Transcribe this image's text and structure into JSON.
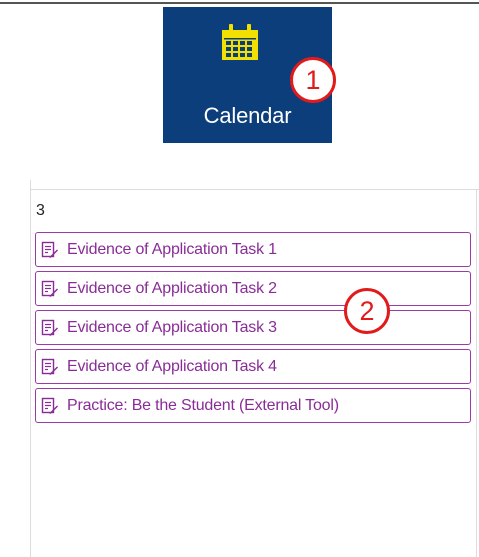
{
  "nav": {
    "calendar_label": "Calendar"
  },
  "callouts": {
    "one": "1",
    "two": "2"
  },
  "day": {
    "number": "3"
  },
  "events": [
    {
      "title": "Evidence of Application Task 1",
      "icon": "assignment-icon"
    },
    {
      "title": "Evidence of Application Task 2",
      "icon": "assignment-icon"
    },
    {
      "title": "Evidence of Application Task 3",
      "icon": "assignment-icon"
    },
    {
      "title": "Evidence of Application Task 4",
      "icon": "assignment-icon"
    },
    {
      "title": "Practice: Be the Student (External Tool)",
      "icon": "assignment-icon"
    }
  ],
  "colors": {
    "nav_bg": "#0d3e7c",
    "icon_yellow": "#f2e000",
    "event_purple": "#8a2c98",
    "callout_red": "#e11b1b"
  }
}
